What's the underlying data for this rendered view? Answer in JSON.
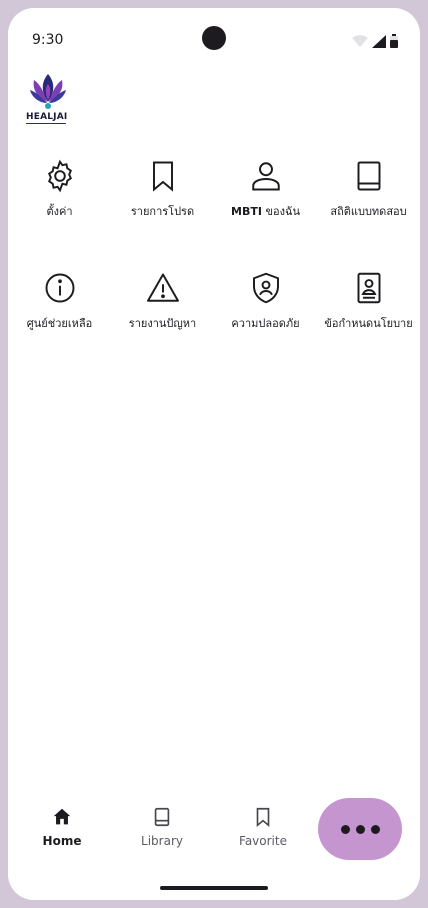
{
  "status_bar": {
    "time": "9:30"
  },
  "logo": {
    "text": "HEALJAI"
  },
  "menu": [
    {
      "label": "ตั้งค่า",
      "icon": "gear-icon"
    },
    {
      "label": "รายการโปรด",
      "icon": "bookmark-icon"
    },
    {
      "label_bold": "MBTI",
      "label_rest": " ของฉัน",
      "icon": "person-icon"
    },
    {
      "label": "สถิติแบบทดสอบ",
      "icon": "book-icon"
    },
    {
      "label": "ศูนย์ช่วยเหลือ",
      "icon": "info-icon"
    },
    {
      "label": "รายงานปัญหา",
      "icon": "warning-icon"
    },
    {
      "label": "ความปลอดภัย",
      "icon": "shield-person-icon"
    },
    {
      "label": "ข้อกำหนดนโยบาย",
      "icon": "contact-book-icon"
    }
  ],
  "bottom_nav": [
    {
      "label": "Home",
      "icon": "home-icon",
      "active": true
    },
    {
      "label": "Library",
      "icon": "library-icon",
      "active": false
    },
    {
      "label": "Favorite",
      "icon": "bookmark-icon",
      "active": false
    }
  ],
  "colors": {
    "fab": "#c595cf",
    "frame": "#d2c7d7"
  }
}
